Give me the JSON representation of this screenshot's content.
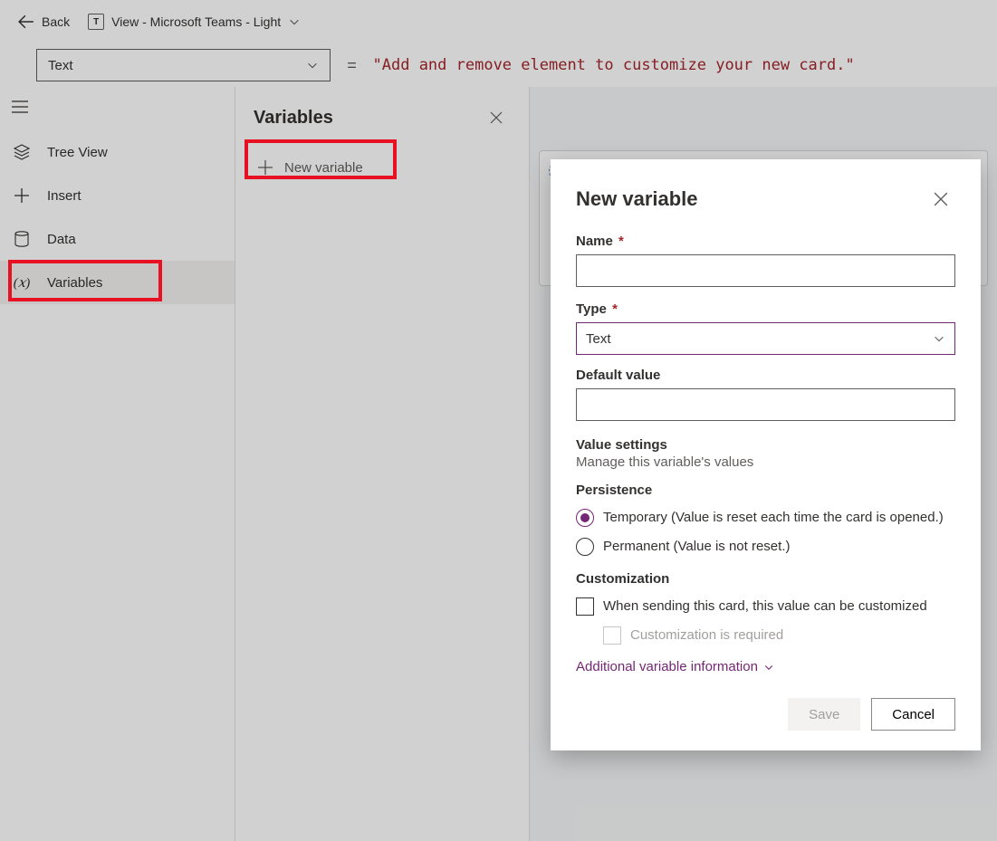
{
  "header": {
    "back": "Back",
    "view_title": "View - Microsoft Teams - Light"
  },
  "formula": {
    "property": "Text",
    "expression": "\"Add and remove element to customize your new card.\""
  },
  "rail": {
    "tree_view": "Tree View",
    "insert": "Insert",
    "data": "Data",
    "variables": "Variables"
  },
  "var_panel": {
    "title": "Variables",
    "new_variable": "New variable"
  },
  "dialog": {
    "title": "New variable",
    "name_label": "Name",
    "type_label": "Type",
    "type_value": "Text",
    "default_label": "Default value",
    "value_settings_h": "Value settings",
    "value_settings_sub": "Manage this variable's values",
    "persistence_h": "Persistence",
    "persist_temp": "Temporary (Value is reset each time the card is opened.)",
    "persist_perm": "Permanent (Value is not reset.)",
    "customization_h": "Customization",
    "custom_opt": "When sending this card, this value can be customized",
    "custom_req": "Customization is required",
    "additional": "Additional variable information",
    "save": "Save",
    "cancel": "Cancel"
  }
}
